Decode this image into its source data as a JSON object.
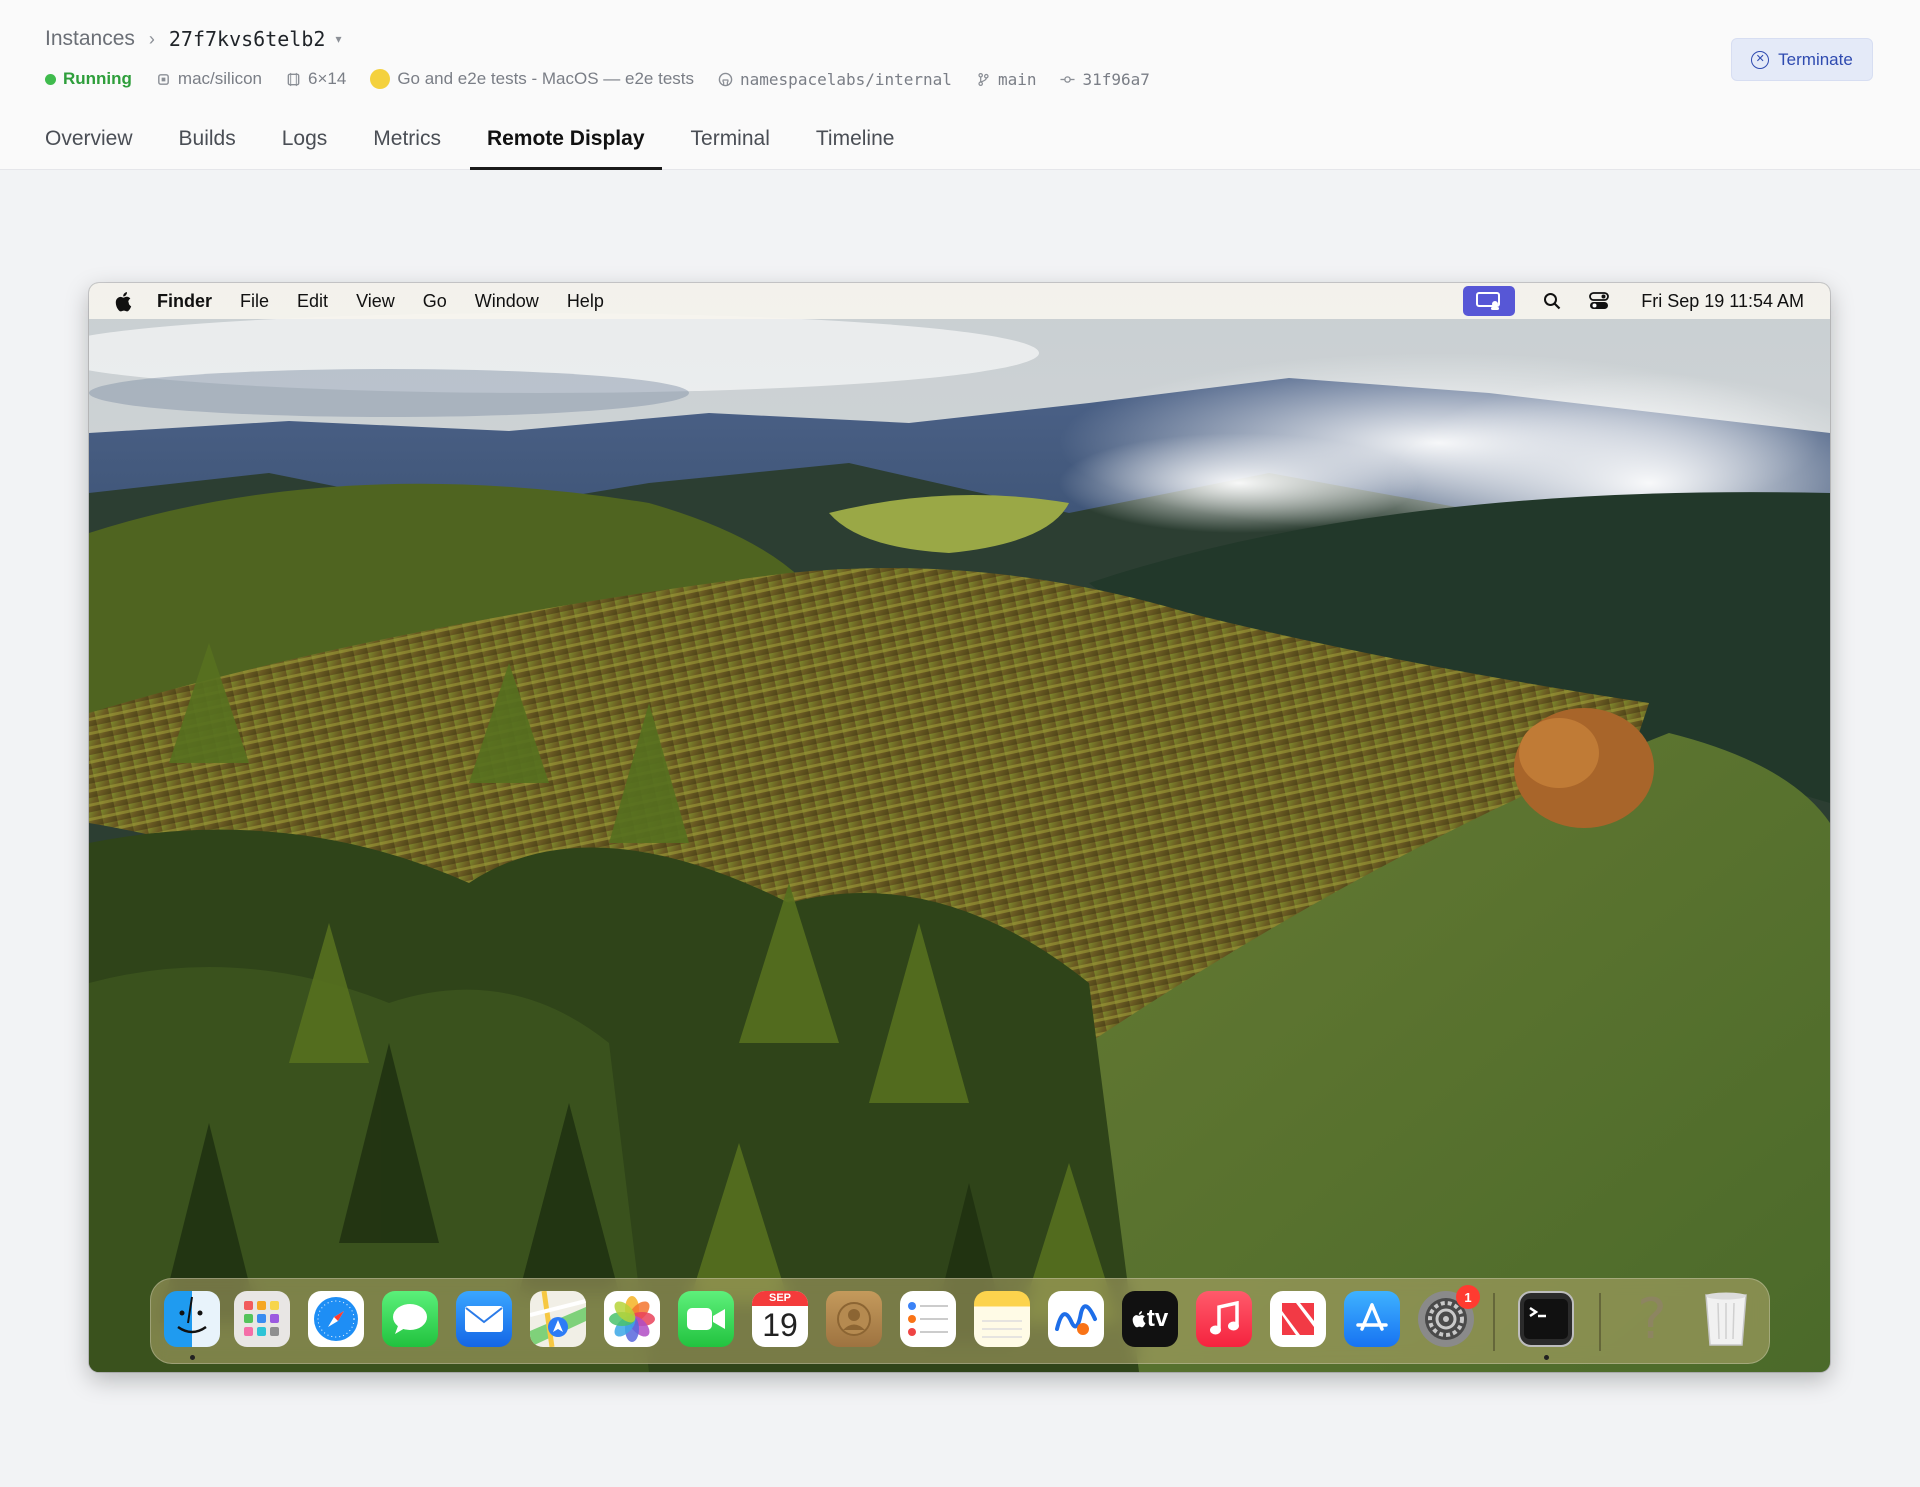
{
  "breadcrumb": {
    "root": "Instances",
    "current": "27f7kvs6telb2"
  },
  "meta": {
    "status": "Running",
    "platform": "mac/silicon",
    "shape": "6×14",
    "workflow": "Go and e2e tests - MacOS — e2e tests",
    "repo": "namespacelabs/internal",
    "branch": "main",
    "commit": "31f96a7"
  },
  "actions": {
    "terminate": "Terminate"
  },
  "tabs": [
    "Overview",
    "Builds",
    "Logs",
    "Metrics",
    "Remote Display",
    "Terminal",
    "Timeline"
  ],
  "active_tab": "Remote Display",
  "mac": {
    "menu": [
      "Finder",
      "File",
      "Edit",
      "View",
      "Go",
      "Window",
      "Help"
    ],
    "clock": "Fri Sep 19  11:54 AM",
    "calendar": {
      "month": "SEP",
      "day": "19"
    },
    "appletv_label": "tv",
    "settings_badge": "1",
    "help_glyph": "?",
    "dock": [
      "finder-icon",
      "launchpad-icon",
      "safari-icon",
      "messages-icon",
      "mail-icon",
      "maps-icon",
      "photos-icon",
      "facetime-icon",
      "calendar-icon",
      "contacts-icon",
      "reminders-icon",
      "notes-icon",
      "freeform-icon",
      "appletv-icon",
      "music-icon",
      "news-icon",
      "appstore-icon",
      "system-settings-icon",
      "terminal-icon",
      "help-icon",
      "trash-icon"
    ]
  },
  "colors": {
    "running": "#3fbb4d",
    "accent": "#2f4bb0",
    "screen_share": "#5757d6",
    "badge": "#ff3b30"
  }
}
